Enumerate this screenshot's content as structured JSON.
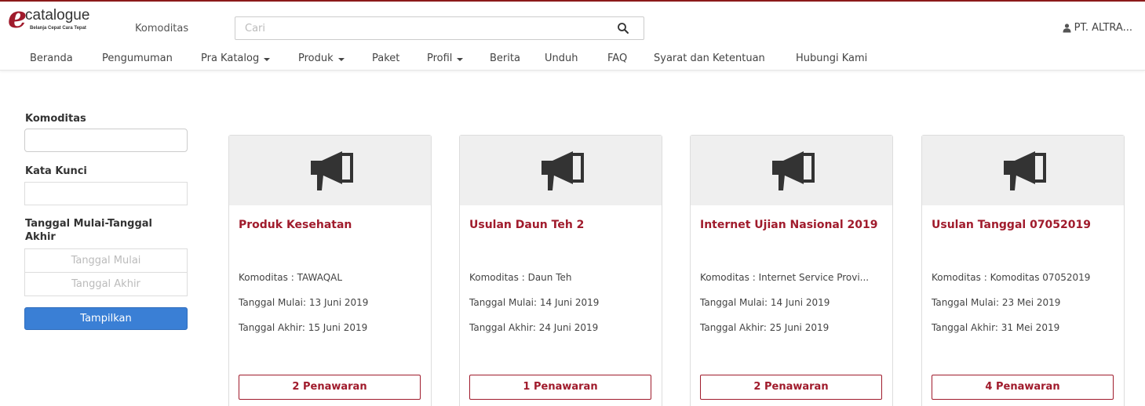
{
  "brand": {
    "logo_letter": "e",
    "logo_word": "catalogue",
    "logo_tagline": "Belanja Cepat Cara Tepat"
  },
  "header": {
    "komoditas_label": "Komoditas",
    "search_placeholder": "Cari",
    "user_name": "PT. ALTRA..."
  },
  "nav": {
    "items": [
      {
        "label": "Beranda"
      },
      {
        "label": "Pengumuman"
      },
      {
        "label": "Pra Katalog"
      },
      {
        "label": "Produk"
      },
      {
        "label": "Paket"
      },
      {
        "label": "Profil"
      },
      {
        "label": "Berita"
      },
      {
        "label": "Unduh"
      },
      {
        "label": "FAQ"
      },
      {
        "label": "Syarat dan Ketentuan"
      },
      {
        "label": "Hubungi Kami"
      }
    ]
  },
  "filter": {
    "komoditas_label": "Komoditas",
    "kata_kunci_label": "Kata Kunci",
    "tanggal_label": "Tanggal Mulai-Tanggal Akhir",
    "tanggal_mulai_placeholder": "Tanggal Mulai",
    "tanggal_akhir_placeholder": "Tanggal Akhir",
    "submit_label": "Tampilkan"
  },
  "cards": [
    {
      "title": "Produk Kesehatan",
      "komoditas": "Komoditas : TAWAQAL",
      "mulai": "Tanggal Mulai: 13 Juni 2019",
      "akhir": "Tanggal Akhir: 15 Juni 2019",
      "button": "2 Penawaran"
    },
    {
      "title": "Usulan Daun Teh 2",
      "komoditas": "Komoditas : Daun Teh",
      "mulai": "Tanggal Mulai: 14 Juni 2019",
      "akhir": "Tanggal Akhir: 24 Juni 2019",
      "button": "1 Penawaran"
    },
    {
      "title": "Internet Ujian Nasional 2019",
      "komoditas": "Komoditas : Internet Service Provi...",
      "mulai": "Tanggal Mulai: 14 Juni 2019",
      "akhir": "Tanggal Akhir: 25 Juni 2019",
      "button": "2 Penawaran"
    },
    {
      "title": "Usulan Tanggal 07052019",
      "komoditas": "Komoditas : Komoditas 07052019",
      "mulai": "Tanggal Mulai: 23 Mei 2019",
      "akhir": "Tanggal Akhir: 31 Mei 2019",
      "button": "4 Penawaran"
    }
  ],
  "colors": {
    "brand_red": "#a01b2c",
    "primary_blue": "#3a7fd5",
    "banner_gray": "#efefef"
  },
  "icons": {
    "search": "search-icon",
    "user": "user-icon",
    "card": "megaphone-icon"
  }
}
